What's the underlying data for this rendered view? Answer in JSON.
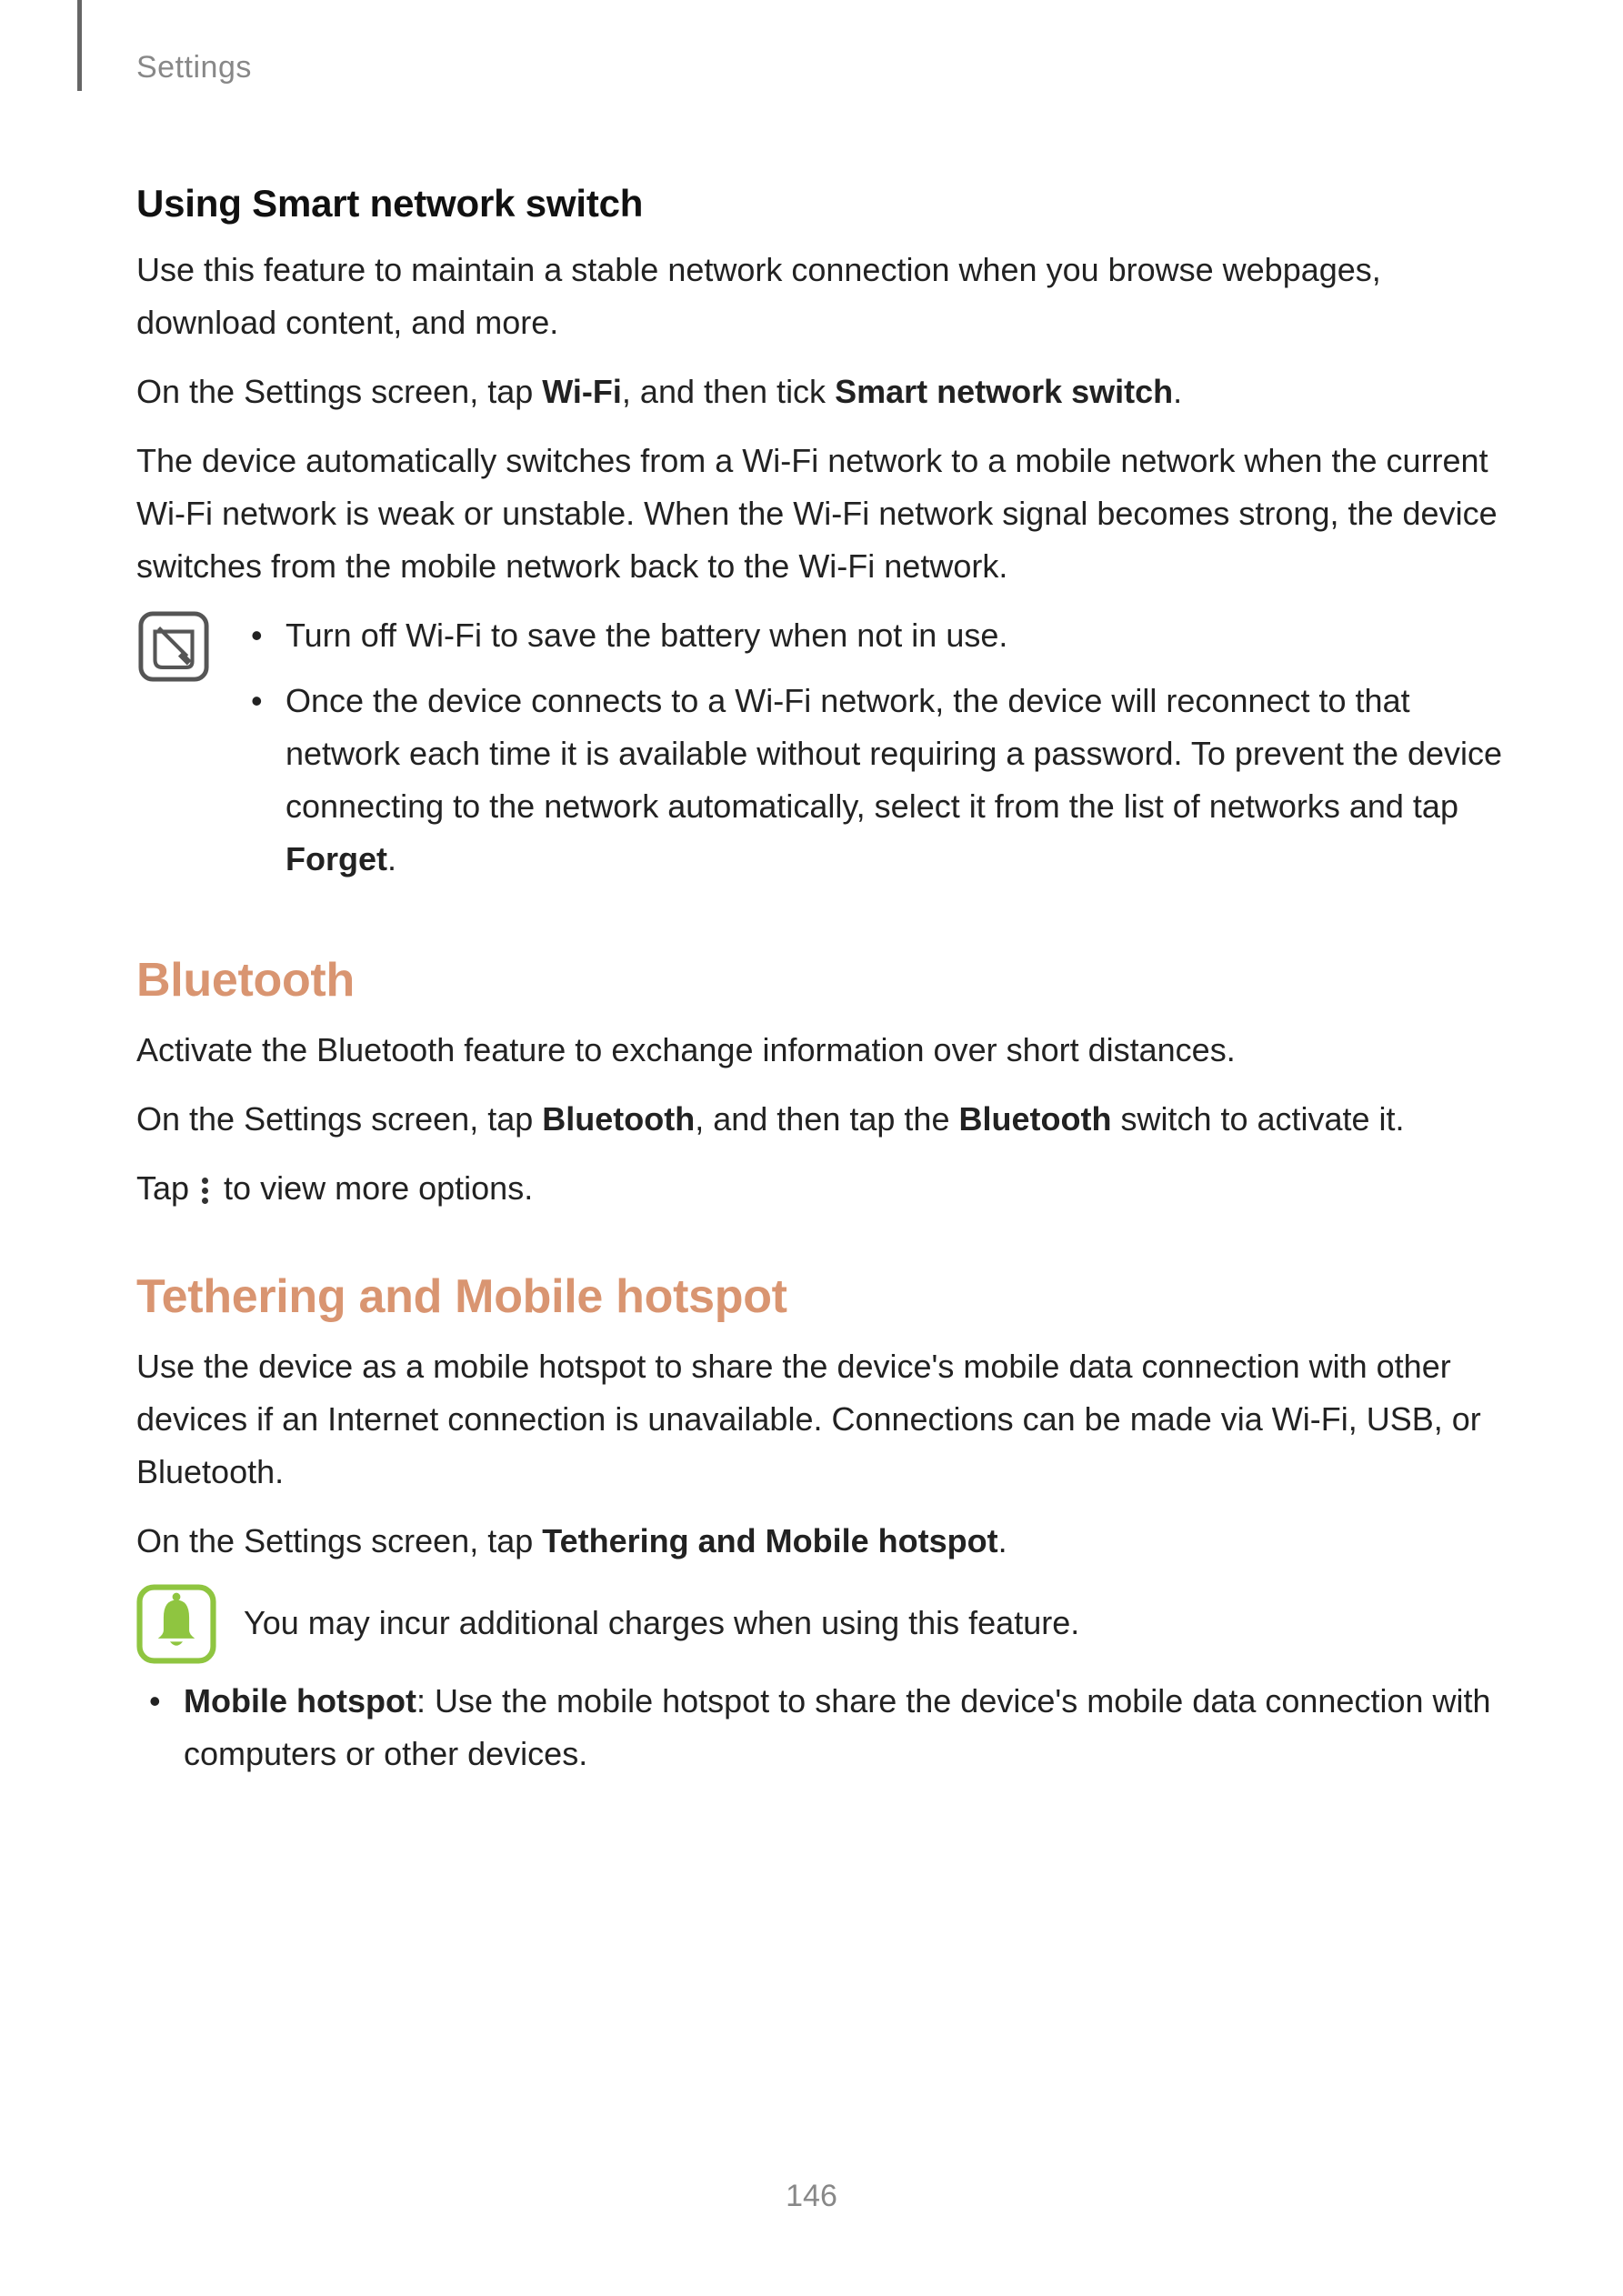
{
  "header": {
    "section": "Settings"
  },
  "page_number": "146",
  "smart_network": {
    "heading": "Using Smart network switch",
    "p1": "Use this feature to maintain a stable network connection when you browse webpages, download content, and more.",
    "p2_a": "On the Settings screen, tap ",
    "p2_b": "Wi-Fi",
    "p2_c": ", and then tick ",
    "p2_d": "Smart network switch",
    "p2_e": ".",
    "p3": "The device automatically switches from a Wi-Fi network to a mobile network when the current Wi-Fi network is weak or unstable. When the Wi-Fi network signal becomes strong, the device switches from the mobile network back to the Wi-Fi network.",
    "tip1": "Turn off Wi-Fi to save the battery when not in use.",
    "tip2_a": "Once the device connects to a Wi-Fi network, the device will reconnect to that network each time it is available without requiring a password. To prevent the device connecting to the network automatically, select it from the list of networks and tap ",
    "tip2_b": "Forget",
    "tip2_c": "."
  },
  "bluetooth": {
    "heading": "Bluetooth",
    "p1": "Activate the Bluetooth feature to exchange information over short distances.",
    "p2_a": "On the Settings screen, tap ",
    "p2_b": "Bluetooth",
    "p2_c": ", and then tap the ",
    "p2_d": "Bluetooth",
    "p2_e": " switch to activate it.",
    "p3_a": "Tap ",
    "p3_b": " to view more options."
  },
  "tethering": {
    "heading": "Tethering and Mobile hotspot",
    "p1": "Use the device as a mobile hotspot to share the device's mobile data connection with other devices if an Internet connection is unavailable. Connections can be made via Wi-Fi, USB, or Bluetooth.",
    "p2_a": "On the Settings screen, tap ",
    "p2_b": "Tethering and Mobile hotspot",
    "p2_c": ".",
    "notice": "You may incur additional charges when using this feature.",
    "item1_a": "Mobile hotspot",
    "item1_b": ": Use the mobile hotspot to share the device's mobile data connection with computers or other devices."
  }
}
